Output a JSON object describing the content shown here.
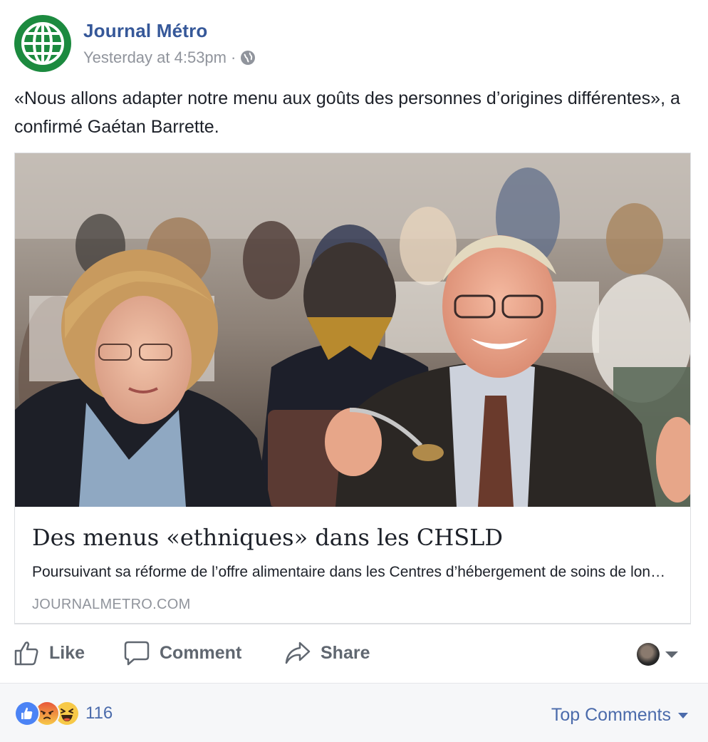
{
  "post": {
    "page_name": "Journal Métro",
    "timestamp": "Yesterday at 4:53pm",
    "separator": "·",
    "privacy_icon": "globe-icon",
    "avatar_icon": "globe-logo-icon",
    "message": "«Nous allons adapter notre menu aux goûts des personnes d’origines différentes», a confirmé Gaétan Barrette."
  },
  "link_card": {
    "image_icon": "article-photo",
    "title": "Des menus «ethniques» dans les CHSLD",
    "description": "Poursuivant sa réforme de l’offre alimentaire dans les Centres d’hébergement de soins de longue durée",
    "domain": "JOURNALMETRO.COM"
  },
  "actions": {
    "like_label": "Like",
    "comment_label": "Comment",
    "share_label": "Share"
  },
  "footer": {
    "reactions": [
      "like",
      "angry",
      "haha"
    ],
    "reaction_count": "116",
    "sort_label": "Top Comments"
  },
  "colors": {
    "brand_blue": "#365899",
    "link_blue": "#4b6bab",
    "avatar_green": "#1c8a3f",
    "meta_gray": "#90949c",
    "action_gray": "#606770"
  }
}
